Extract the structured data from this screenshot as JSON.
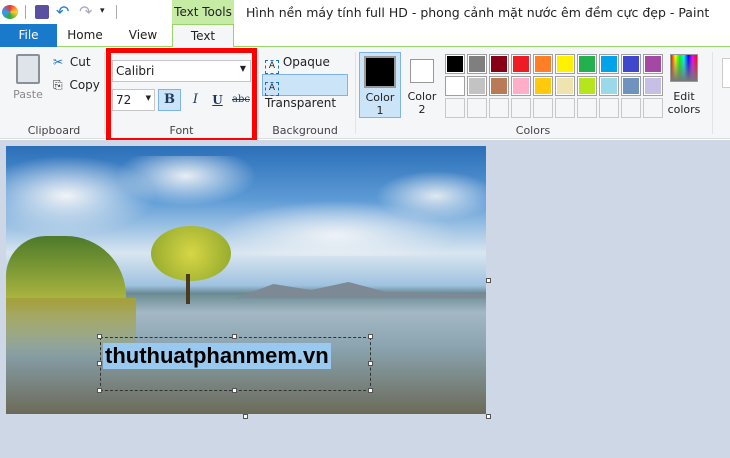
{
  "title": "Hình nền máy tính full HD - phong cảnh mặt nước êm đềm cực đẹp - Paint",
  "contextual_tab_group": "Text Tools",
  "tabs": [
    "File",
    "Home",
    "View",
    "Text"
  ],
  "clipboard": {
    "paste": "Paste",
    "cut": "Cut",
    "copy": "Copy",
    "label": "Clipboard"
  },
  "font": {
    "family": "Calibri",
    "size": "72",
    "bold": "B",
    "italic": "I",
    "underline": "U",
    "strike": "abc",
    "label": "Font"
  },
  "background": {
    "opaque": "Opaque",
    "transparent": "Transparent",
    "label": "Background"
  },
  "colors": {
    "color1": "Color",
    "color1_num": "1",
    "color2": "Color",
    "color2_num": "2",
    "edit": "Edit",
    "edit2": "colors",
    "label": "Colors",
    "palette": [
      "#000000",
      "#7f7f7f",
      "#880015",
      "#ed1c24",
      "#ff7f27",
      "#fff200",
      "#22b14c",
      "#00a2e8",
      "#3f48cc",
      "#a349a4",
      "#ffffff",
      "#c3c3c3",
      "#b97a57",
      "#ffaec9",
      "#ffc90e",
      "#efe4b0",
      "#b5e61d",
      "#99d9ea",
      "#7092be",
      "#c8bfe7"
    ]
  },
  "text_box": {
    "content": "thuthuatphanmem.vn"
  },
  "highlight_color": "#ff0000"
}
